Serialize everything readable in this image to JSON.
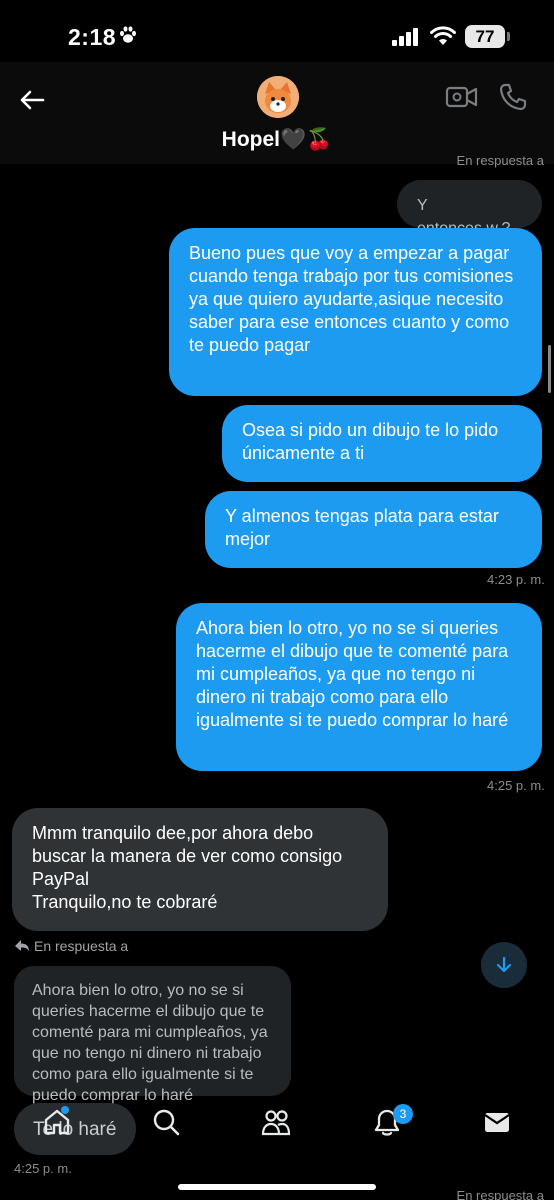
{
  "status": {
    "time": "2:18",
    "battery": "77"
  },
  "header": {
    "contact_name": "Hopel🖤🍒"
  },
  "labels": {
    "reply_top": "En respuesta a",
    "reply": "En respuesta a",
    "reply_bottom": "En respuesta a"
  },
  "messages": [
    {
      "text": "Y entonces.w.?"
    },
    {
      "text": "Bueno pues que voy a empezar a pagar cuando tenga trabajo por tus comisiones ya que quiero ayudarte,asique necesito saber para ese entonces cuanto y como te puedo pagar"
    },
    {
      "text": "Osea si pido un dibujo te lo pido únicamente a ti"
    },
    {
      "text": "Y almenos tengas plata para estar mejor",
      "time": "4:23 p. m."
    },
    {
      "text": "Ahora bien lo otro, yo no se si queries hacerme el dibujo que te comenté para mi cumpleaños, ya que no tengo ni dinero ni trabajo como para ello igualmente si te puedo comprar  lo haré",
      "time": "4:25 p. m."
    },
    {
      "text": "Mmm tranquilo dee,por ahora debo buscar la manera de ver como consigo PayPal\nTranquilo,no te cobraré"
    },
    {
      "text": "Ahora bien lo otro, yo no se si queries hacerme el dibujo que te comenté para mi cumpleaños, ya que no tengo ni dinero ni trabajo como para ello igualmente si te puedo comprar  lo haré"
    },
    {
      "text": "Te lo haré",
      "time": "4:25 p. m."
    }
  ],
  "nav": {
    "notifications_count": "3"
  },
  "colors": {
    "accent": "#1d9bf0",
    "incoming": "#2f3336",
    "background": "#000000"
  }
}
